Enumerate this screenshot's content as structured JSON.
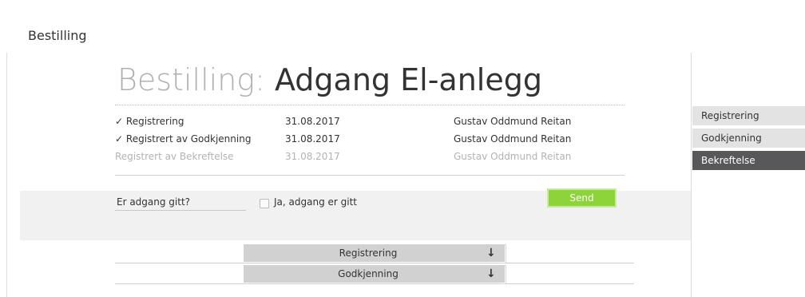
{
  "breadcrumb": "Bestilling",
  "title": {
    "prefix": "Bestilling:",
    "name": "Adgang El-anlegg"
  },
  "history": [
    {
      "check": "✓",
      "label": "Registrering",
      "date": "31.08.2017",
      "user": "Gustav Oddmund Reitan",
      "done": true
    },
    {
      "check": "✓",
      "label": "Registrert av Godkjenning",
      "date": "31.08.2017",
      "user": "Gustav Oddmund Reitan",
      "done": true
    },
    {
      "check": "",
      "label": "Registrert av Bekreftelse",
      "date": "31.08.2017",
      "user": "Gustav Oddmund Reitan",
      "done": false
    }
  ],
  "form": {
    "question": "Er adgang gitt?",
    "checkbox_label": "Ja, adgang er gitt",
    "checked": false,
    "send_label": "Send",
    "send_color": "#8cd43a"
  },
  "accordion": [
    {
      "label": "Registrering",
      "arrow": "↓"
    },
    {
      "label": "Godkjenning",
      "arrow": "↓"
    }
  ],
  "sidebar": {
    "items": [
      {
        "label": "Registrering",
        "active": false
      },
      {
        "label": "Godkjenning",
        "active": false
      },
      {
        "label": "Bekreftelse",
        "active": true
      }
    ],
    "active_color": "#58585a"
  }
}
